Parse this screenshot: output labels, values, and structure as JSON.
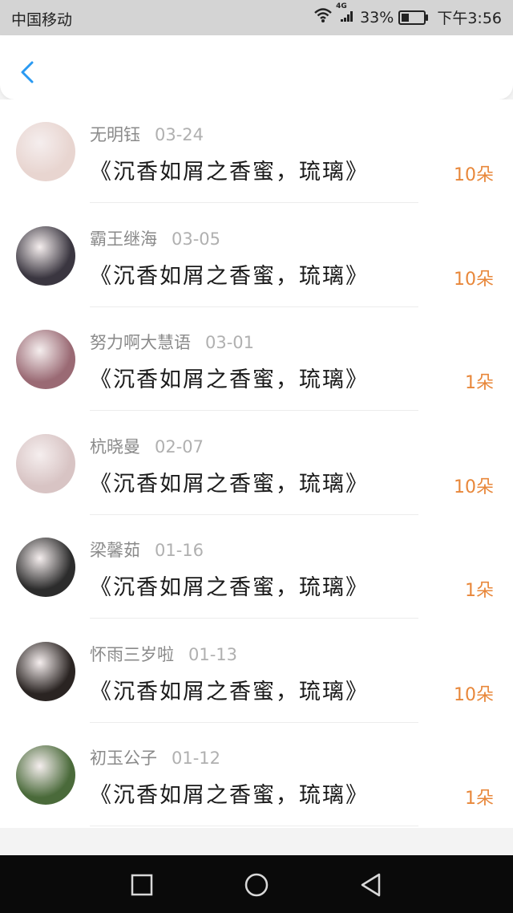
{
  "status_bar": {
    "carrier": "中国移动",
    "network": "4G",
    "battery": "33%",
    "battery_level": 0.33,
    "time": "下午3:56",
    "icons": [
      "wifi-icon",
      "signal-icon",
      "battery-icon"
    ]
  },
  "header": {
    "back_icon": "chevron-left-icon",
    "accent_color": "#2a9af2"
  },
  "gifts": [
    {
      "name": "无明钰",
      "date": "03-24",
      "title": "《沉香如屑之香蜜，琉璃》",
      "amount": "10朵",
      "avatar_color": "#e8d5d0"
    },
    {
      "name": "霸王继海",
      "date": "03-05",
      "title": "《沉香如屑之香蜜，琉璃》",
      "amount": "10朵",
      "avatar_color": "#3a3640"
    },
    {
      "name": "努力啊大慧语",
      "date": "03-01",
      "title": "《沉香如屑之香蜜，琉璃》",
      "amount": "1朵",
      "avatar_color": "#9a6a74"
    },
    {
      "name": "杭晓曼",
      "date": "02-07",
      "title": "《沉香如屑之香蜜，琉璃》",
      "amount": "10朵",
      "avatar_color": "#d8c4c4"
    },
    {
      "name": "梁馨茹",
      "date": "01-16",
      "title": "《沉香如屑之香蜜，琉璃》",
      "amount": "1朵",
      "avatar_color": "#2c2c2c"
    },
    {
      "name": "怀雨三岁啦",
      "date": "01-13",
      "title": "《沉香如屑之香蜜，琉璃》",
      "amount": "10朵",
      "avatar_color": "#2a2422"
    },
    {
      "name": "初玉公子",
      "date": "01-12",
      "title": "《沉香如屑之香蜜，琉璃》",
      "amount": "1朵",
      "avatar_color": "#4a6a3a"
    }
  ],
  "amount_color": "#e8873a",
  "nav_bar": {
    "buttons": [
      "recents-square-icon",
      "home-circle-icon",
      "back-triangle-icon"
    ]
  }
}
